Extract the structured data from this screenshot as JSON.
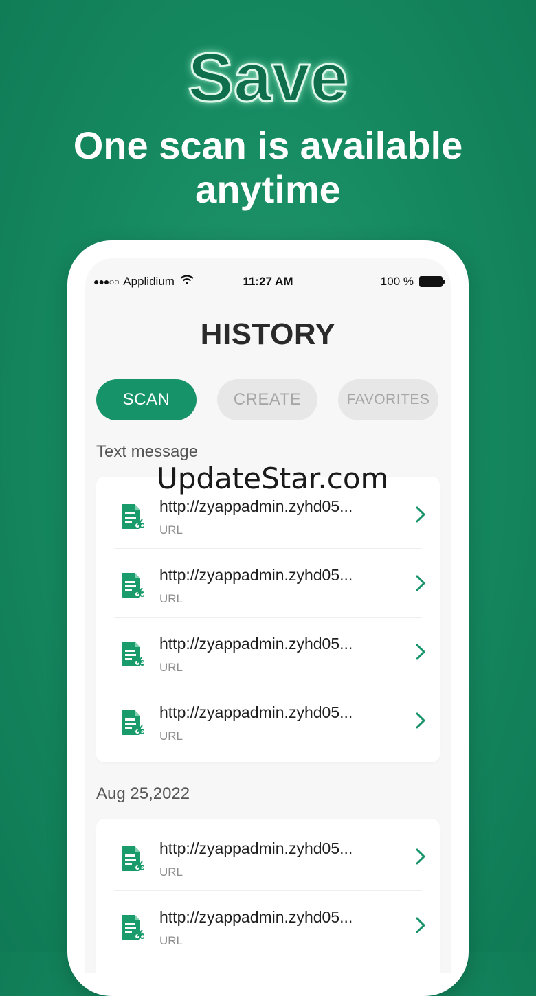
{
  "promo": {
    "title": "Save",
    "subtitle_line1": "One scan is available",
    "subtitle_line2": "anytime"
  },
  "status_bar": {
    "signal": "●●●○○",
    "carrier": "Applidium",
    "time": "11:27 AM",
    "battery": "100 %"
  },
  "screen": {
    "title": "HISTORY",
    "tabs": [
      {
        "label": "SCAN",
        "active": true
      },
      {
        "label": "CREATE",
        "active": false
      },
      {
        "label": "FAVORITES",
        "active": false
      }
    ]
  },
  "sections": [
    {
      "label": "Text message",
      "items": [
        {
          "title": "http://zyappadmin.zyhd05...",
          "type": "URL"
        },
        {
          "title": "http://zyappadmin.zyhd05...",
          "type": "URL"
        },
        {
          "title": "http://zyappadmin.zyhd05...",
          "type": "URL"
        },
        {
          "title": "http://zyappadmin.zyhd05...",
          "type": "URL"
        }
      ]
    },
    {
      "label": "Aug 25,2022",
      "items": [
        {
          "title": "http://zyappadmin.zyhd05...",
          "type": "URL"
        },
        {
          "title": "http://zyappadmin.zyhd05...",
          "type": "URL"
        }
      ]
    }
  ],
  "watermark": "UpdateStar.com",
  "colors": {
    "brand_green": "#17936a",
    "background_green": "#168a61",
    "icon_green": "#1a9b6b"
  },
  "icons": {
    "item_icon": "document-scissors-icon",
    "chevron": "chevron-right-icon",
    "wifi": "wifi-icon",
    "battery": "battery-icon"
  }
}
